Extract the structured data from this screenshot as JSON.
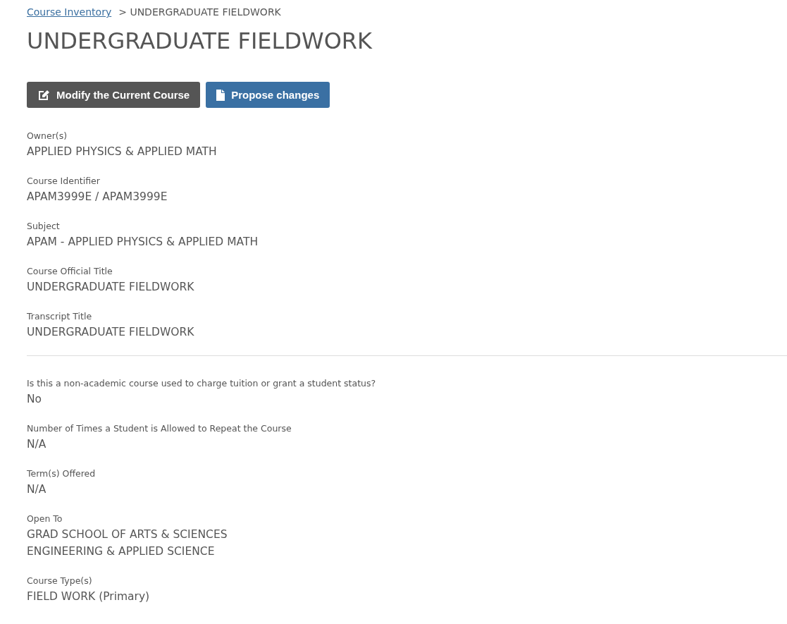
{
  "breadcrumb": {
    "link": "Course Inventory",
    "current": "> UNDERGRADUATE FIELDWORK"
  },
  "title": "UNDERGRADUATE FIELDWORK",
  "buttons": [
    {
      "label": "Modify the Current Course",
      "kind": "edit"
    },
    {
      "label": "Propose changes",
      "kind": "propose"
    }
  ],
  "sections": [
    {
      "fields": [
        {
          "label": "Owner(s)",
          "values": [
            "APPLIED PHYSICS & APPLIED MATH"
          ]
        },
        {
          "label": "Course Identifier",
          "values": [
            "APAM3999E / APAM3999E"
          ]
        },
        {
          "label": "Subject",
          "values": [
            "APAM - APPLIED PHYSICS & APPLIED MATH"
          ]
        },
        {
          "label": "Course Official Title",
          "values": [
            "UNDERGRADUATE FIELDWORK"
          ]
        },
        {
          "label": "Transcript Title",
          "values": [
            "UNDERGRADUATE FIELDWORK"
          ]
        }
      ]
    },
    {
      "fields": [
        {
          "label": "Is this a non-academic course used to charge tuition or grant a student status?",
          "values": [
            "No"
          ]
        },
        {
          "label": "Number of Times a Student is Allowed to Repeat the Course",
          "values": [
            "N/A"
          ]
        },
        {
          "label": "Term(s) Offered",
          "values": [
            "N/A"
          ]
        },
        {
          "label": "Open To",
          "values": [
            "GRAD SCHOOL OF ARTS & SCIENCES",
            "ENGINEERING & APPLIED SCIENCE"
          ]
        },
        {
          "label": "Course Type(s)",
          "values": [
            "FIELD WORK (Primary)"
          ]
        }
      ]
    }
  ]
}
